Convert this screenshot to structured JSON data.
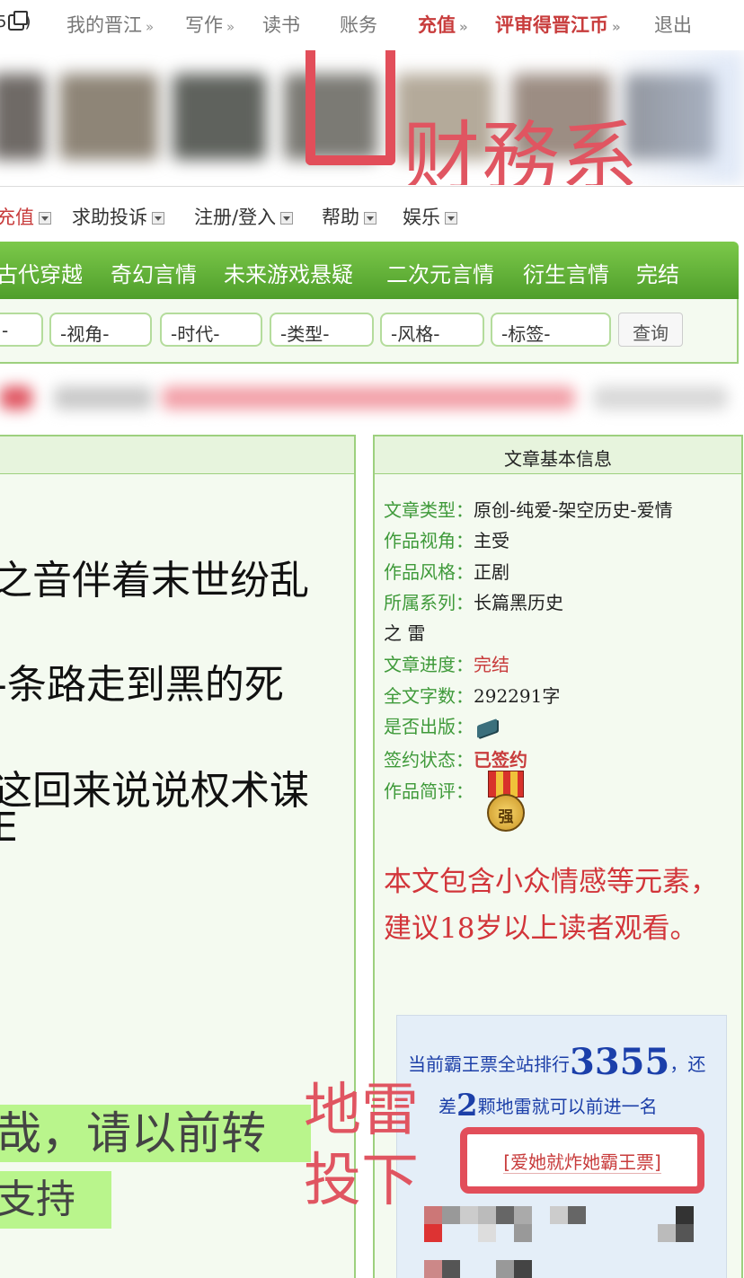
{
  "topnav": {
    "first": "5",
    "items": [
      "我的晋江",
      "写作",
      "读书",
      "账务",
      "充值",
      "评审得晋江币",
      "退出"
    ]
  },
  "annotation": {
    "label": "财務系"
  },
  "menu": {
    "items": [
      "充值",
      "求助投诉",
      "注册/登入",
      "帮助",
      "娱乐"
    ]
  },
  "categories": [
    "古代穿越",
    "奇幻言情",
    "未来游戏悬疑",
    "二次元言情",
    "衍生言情",
    "完结"
  ],
  "filters": {
    "options": [
      "-",
      "-视角-",
      "-时代-",
      "-类型-",
      "-风格-",
      "-标签-"
    ],
    "button": "查询"
  },
  "content": {
    "lines": [
      "之音伴着末世纷乱",
      "-条路走到黑的死",
      "这回来说说权术谋",
      "E"
    ],
    "highlight": [
      "哉，请以前转",
      "支持"
    ]
  },
  "info": {
    "title": "文章基本信息",
    "rows": [
      {
        "k": "文章类型：",
        "v": "原创-纯爱-架空历史-爱情"
      },
      {
        "k": "作品视角：",
        "v": "主受"
      },
      {
        "k": "作品风格：",
        "v": "正剧"
      },
      {
        "k": "所属系列：",
        "v": "长篇黑历史"
      },
      {
        "k": "",
        "v": "之 雷"
      },
      {
        "k": "文章进度：",
        "v": "完结"
      },
      {
        "k": "全文字数：",
        "v": "292291字"
      },
      {
        "k": "是否出版：",
        "v": ""
      },
      {
        "k": "签约状态：",
        "v": "已签约"
      },
      {
        "k": "作品简评：",
        "v": ""
      }
    ],
    "medal": "强",
    "warning": "本文包含小众情感等元素，建议18岁以上读者观看。",
    "rank": {
      "prefix": "当前霸王票全站排行",
      "value": "3355",
      "suffix": "，还",
      "line2_prefix": "差",
      "mines": "2",
      "line2_suffix": "颗地雷就可以前进一名"
    },
    "mine_button": "[爱她就炸她霸王票]"
  },
  "mine_annotation": {
    "line1": "地雷",
    "line2": "投下"
  },
  "colors": {
    "green": "#5aa832",
    "red_annotation": "#e24e5a",
    "rank_blue": "#1c3fa8",
    "warn_red": "#d2353a"
  }
}
